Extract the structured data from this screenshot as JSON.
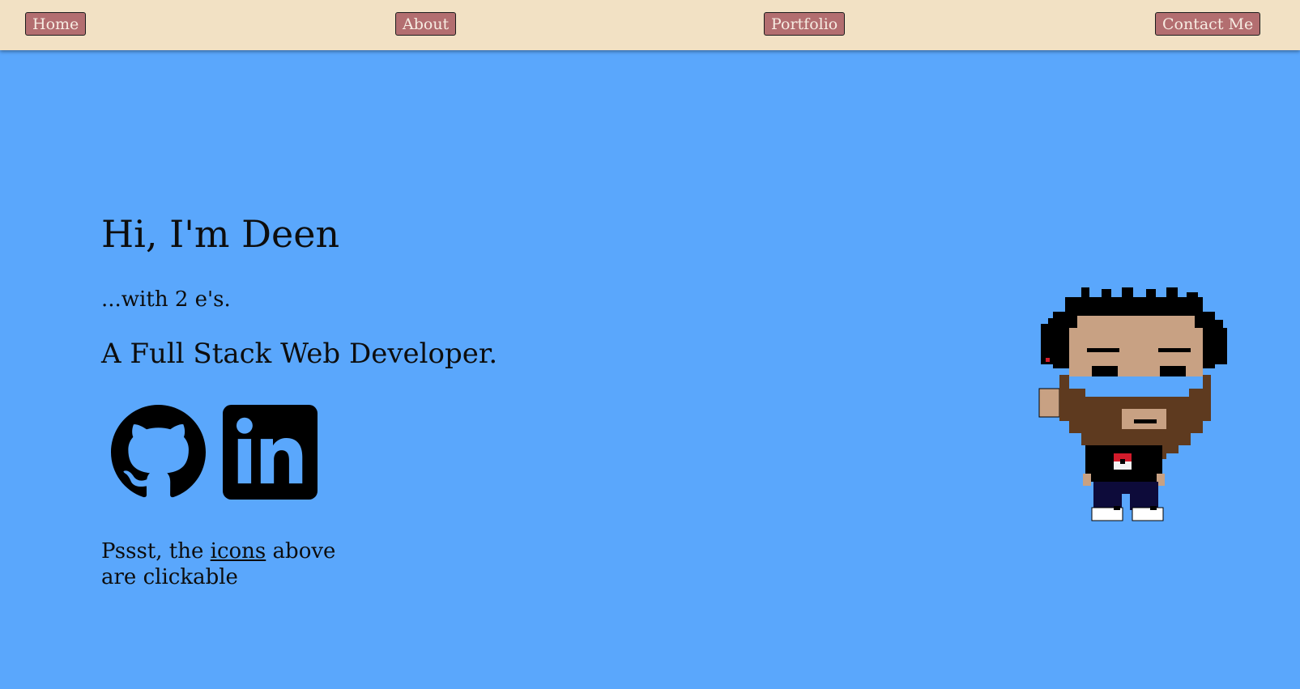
{
  "nav": {
    "items": [
      {
        "label": "Home"
      },
      {
        "label": "About"
      },
      {
        "label": "Portfolio"
      },
      {
        "label": "Contact Me"
      }
    ]
  },
  "hero": {
    "title": "Hi, I'm Deen",
    "subtitle": "...with 2 e's.",
    "role": "A Full Stack Web Developer."
  },
  "social": {
    "github_icon": "github-icon",
    "linkedin_icon": "linkedin-icon"
  },
  "hint": {
    "prefix": "Pssst, the ",
    "link": "icons",
    "suffix": " above are clickable"
  },
  "avatar": {
    "icon": "pixel-avatar-icon"
  },
  "colors": {
    "background": "#5aa7fc",
    "navbar": "#f2e1c4",
    "button": "#b36e70",
    "button_text": "#f7ece2",
    "text": "#0d0d0d"
  }
}
